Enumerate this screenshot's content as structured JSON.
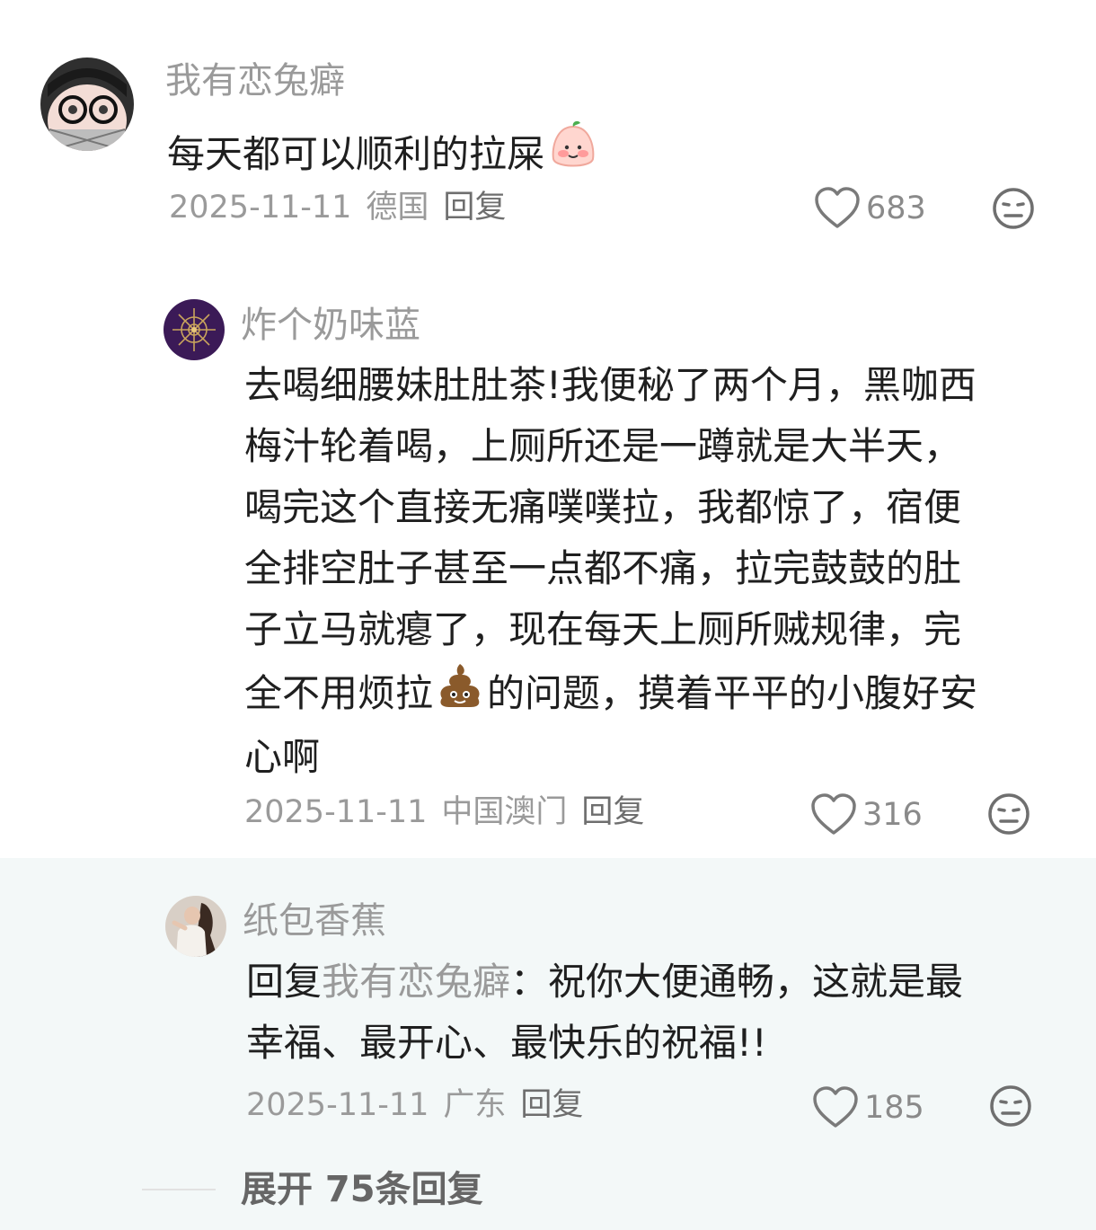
{
  "comments": [
    {
      "username": "我有恋兔癖",
      "text_lines": [
        "每天都可以顺利的拉屎"
      ],
      "emoji": "peach-face-emoji",
      "date": "2025-11-11",
      "location": "德国",
      "reply_label": "回复",
      "likes": "683",
      "reaction_icon": "neutral-face-icon"
    },
    {
      "username": "炸个奶味蓝",
      "text_lines": [
        "去喝细腰妹肚肚茶!我便秘了两个月，黑咖西",
        "梅汁轮着喝，上厕所还是一蹲就是大半天，",
        "喝完这个直接无痛噗噗拉，我都惊了，宿便",
        "全排空肚子甚至一点都不痛，拉完鼓鼓的肚",
        "子立马就瘪了，现在每天上厕所贼规律，完",
        "全不用烦拉",
        "的问题，摸着平平的小腹好安",
        "心啊"
      ],
      "emoji": "poop-emoji",
      "date": "2025-11-11",
      "location": "中国澳门",
      "reply_label": "回复",
      "likes": "316",
      "reaction_icon": "neutral-face-icon"
    },
    {
      "username": "纸包香蕉",
      "reply_prefix": "回复",
      "reply_to": "我有恋兔癖",
      "text_lines": [
        "：祝你大便通畅，这就是最",
        "幸福、最开心、最快乐的祝福!!"
      ],
      "date": "2025-11-11",
      "location": "广东",
      "reply_label": "回复",
      "likes": "185",
      "reaction_icon": "neutral-face-icon"
    }
  ],
  "expand": {
    "label": "展开 75条回复"
  },
  "colors": {
    "username": "#9a9a9a",
    "text": "#1f1f1f",
    "meta": "#9a9a9a",
    "reply_bg": "#f3f8f8"
  }
}
